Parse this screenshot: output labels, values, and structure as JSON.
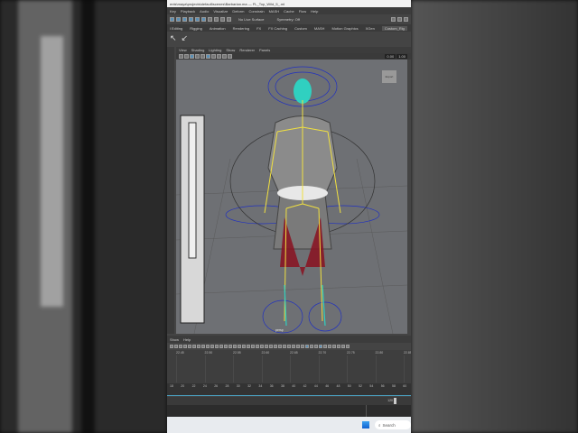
{
  "title": "ents\\maya\\projects\\default\\scenes\\Barbarian.ma  —  FL_Top_Wild_5_.ml",
  "menu": [
    "Key",
    "Playback",
    "Audio",
    "Visualize",
    "Deform",
    "Constrain",
    "MASH",
    "Cache",
    "Flow",
    "Help"
  ],
  "toolbar": {
    "surface": "No Live Surface",
    "symmetry": "Symmetry: Off"
  },
  "shelf_tabs": [
    "l Editing",
    "Rigging",
    "Animation",
    "Rendering",
    "FX",
    "FX Caching",
    "Custom",
    "MASH",
    "Motion Graphics",
    "XGen",
    "Custom_Rig"
  ],
  "panel_menu": [
    "View",
    "Shading",
    "Lighting",
    "Show",
    "Renderer",
    "Panels"
  ],
  "viewport": {
    "field1": "0.00",
    "field2": "1.00",
    "camera_label": "persp",
    "corner_button": "Export"
  },
  "graph_menu": [
    "Show",
    "Help"
  ],
  "graph_ticks": [
    "22.45",
    "22.50",
    "22.55",
    "22.60",
    "22.65",
    "22.70",
    "22.75",
    "22.80",
    "22.85"
  ],
  "time_ticks": [
    "18",
    "20",
    "22",
    "24",
    "26",
    "28",
    "30",
    "32",
    "34",
    "36",
    "38",
    "40",
    "42",
    "44",
    "46",
    "48",
    "50",
    "52",
    "54",
    "56",
    "58",
    "60"
  ],
  "range_end": "120",
  "taskbar": {
    "search": "Search"
  },
  "colors": {
    "joint": "#f0e040",
    "control": "#2030c0",
    "selected": "#30d0c0"
  }
}
